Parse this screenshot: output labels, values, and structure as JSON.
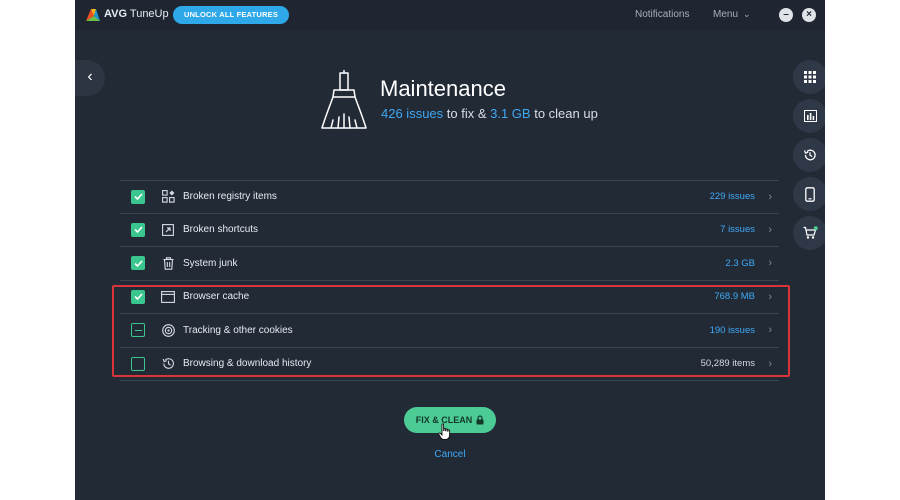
{
  "titlebar": {
    "brand": "AVG",
    "product": "TuneUp",
    "unlock_label": "UNLOCK ALL FEATURES",
    "notifications_label": "Notifications",
    "menu_label": "Menu"
  },
  "header": {
    "title": "Maintenance",
    "issues_count": "426 issues",
    "issues_suffix": " to fix & ",
    "size": "3.1 GB",
    "size_suffix": " to clean up"
  },
  "items": [
    {
      "label": "Broken registry items",
      "value": "229 issues",
      "state": "checked",
      "icon": "registry-icon"
    },
    {
      "label": "Broken shortcuts",
      "value": "7 issues",
      "state": "checked",
      "icon": "shortcut-icon"
    },
    {
      "label": "System junk",
      "value": "2.3 GB",
      "state": "checked",
      "icon": "trash-icon"
    },
    {
      "label": "Browser cache",
      "value": "768.9 MB",
      "state": "checked",
      "icon": "browser-window-icon"
    },
    {
      "label": "Tracking & other cookies",
      "value": "190 issues",
      "state": "partial",
      "icon": "tracking-icon"
    },
    {
      "label": "Browsing & download history",
      "value": "50,289 items",
      "state": "unchecked",
      "icon": "history-icon"
    }
  ],
  "actions": {
    "fix_label": "FIX & CLEAN",
    "cancel_label": "Cancel"
  },
  "colors": {
    "background": "#222a36",
    "accent_blue": "#3fa9f5",
    "accent_green": "#4ccb95",
    "highlight_red": "#d9343c"
  }
}
